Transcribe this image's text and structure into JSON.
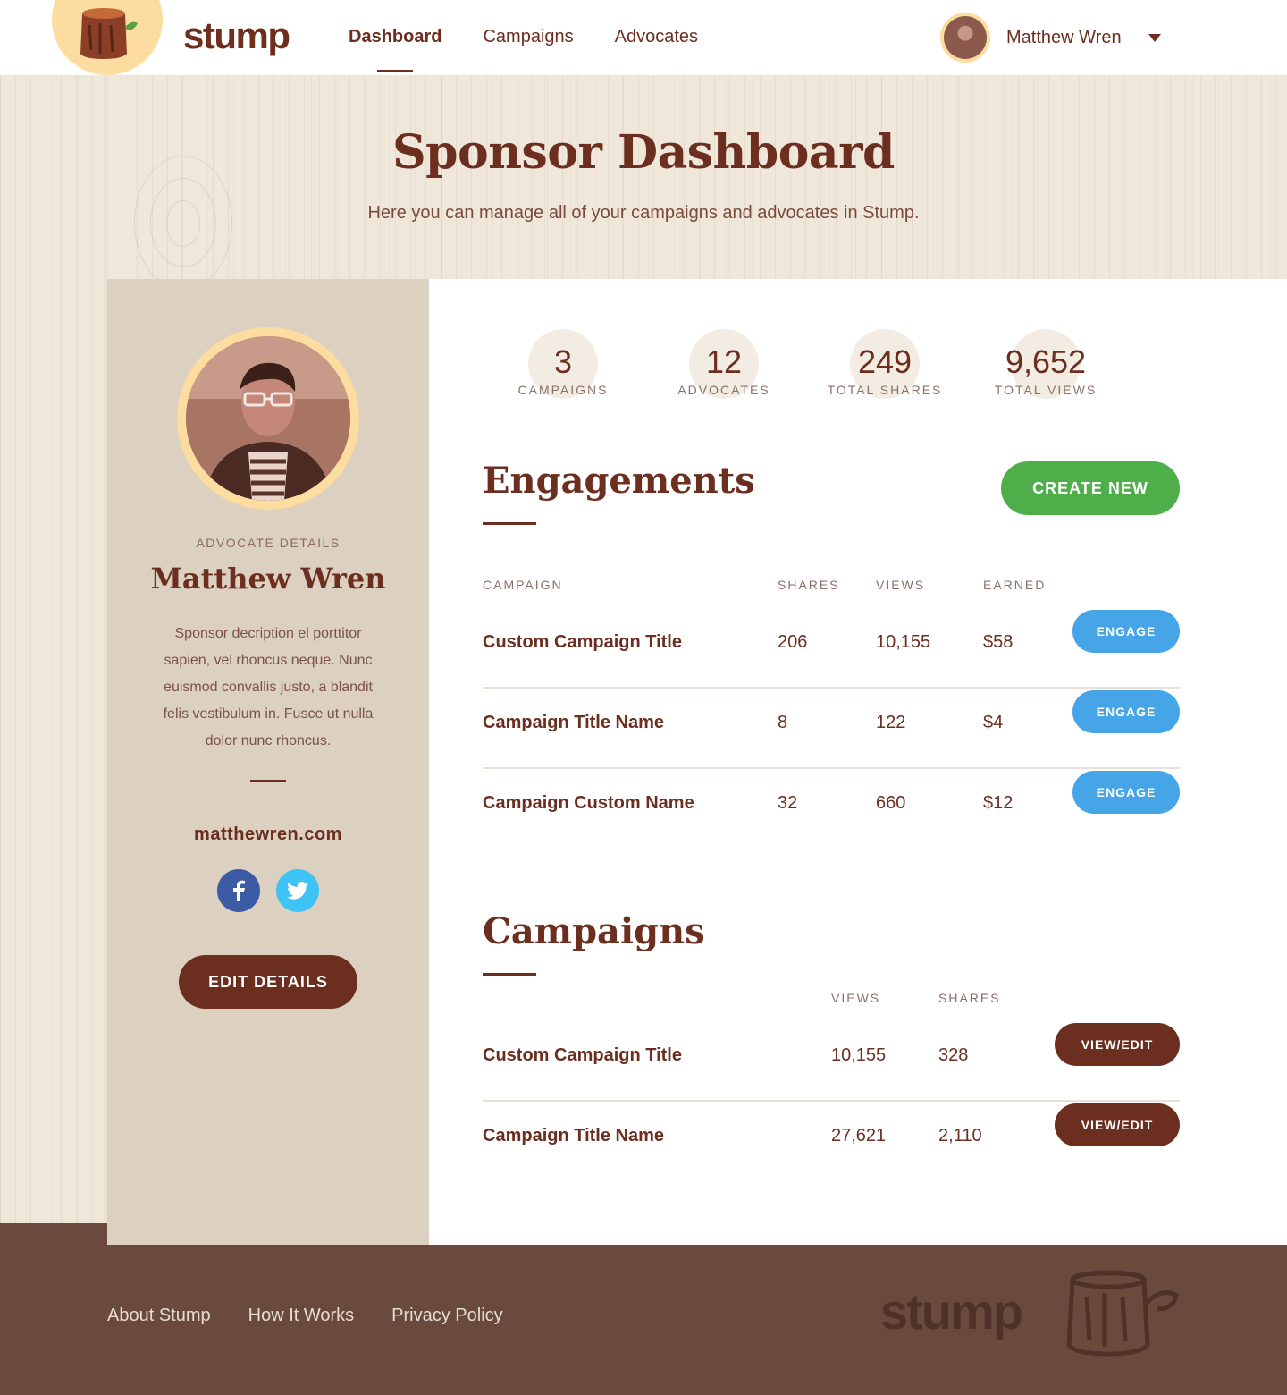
{
  "header": {
    "brand": "stump",
    "nav": [
      {
        "label": "Dashboard",
        "active": true
      },
      {
        "label": "Campaigns",
        "active": false
      },
      {
        "label": "Advocates",
        "active": false
      }
    ],
    "user_name": "Matthew Wren"
  },
  "hero": {
    "title": "Sponsor Dashboard",
    "subtitle": "Here you can manage all of your campaigns and advocates in Stump."
  },
  "advocate": {
    "label": "ADVOCATE DETAILS",
    "name": "Matthew Wren",
    "description": "Sponsor decription el porttitor sapien, vel rhoncus neque. Nunc euismod convallis justo, a blandit felis vestibulum in. Fusce ut nulla dolor nunc rhoncus.",
    "website": "matthewren.com",
    "edit_label": "EDIT DETAILS"
  },
  "stats": [
    {
      "value": "3",
      "label": "CAMPAIGNS"
    },
    {
      "value": "12",
      "label": "ADVOCATES"
    },
    {
      "value": "249",
      "label": "TOTAL SHARES"
    },
    {
      "value": "9,652",
      "label": "TOTAL VIEWS"
    }
  ],
  "engagements": {
    "title": "Engagements",
    "create_label": "CREATE NEW",
    "columns": {
      "campaign": "CAMPAIGN",
      "shares": "SHARES",
      "views": "VIEWS",
      "earned": "EARNED"
    },
    "action_label": "ENGAGE",
    "rows": [
      {
        "title": "Custom Campaign Title",
        "shares": "206",
        "views": "10,155",
        "earned": "$58"
      },
      {
        "title": "Campaign Title Name",
        "shares": "8",
        "views": "122",
        "earned": "$4"
      },
      {
        "title": "Campaign Custom Name",
        "shares": "32",
        "views": "660",
        "earned": "$12"
      }
    ]
  },
  "campaigns": {
    "title": "Campaigns",
    "columns": {
      "views": "VIEWS",
      "shares": "SHARES"
    },
    "action_label": "VIEW/EDIT",
    "rows": [
      {
        "title": "Custom Campaign Title",
        "views": "10,155",
        "shares": "328"
      },
      {
        "title": "Campaign Title Name",
        "views": "27,621",
        "shares": "2,110"
      }
    ]
  },
  "footer": {
    "links": [
      "About Stump",
      "How It Works",
      "Privacy Policy"
    ],
    "brand": "stump"
  },
  "colors": {
    "brand_brown": "#6b2e1f",
    "create_green": "#4dae4a",
    "engage_blue": "#45a5e6",
    "facebook": "#3b5ba5",
    "twitter": "#3dc3f5",
    "footer_bg": "#6b4a3e"
  },
  "icons": {
    "facebook": "facebook-icon",
    "twitter": "twitter-icon",
    "dropdown": "chevron-down-icon",
    "logo": "stump-logo-icon"
  }
}
